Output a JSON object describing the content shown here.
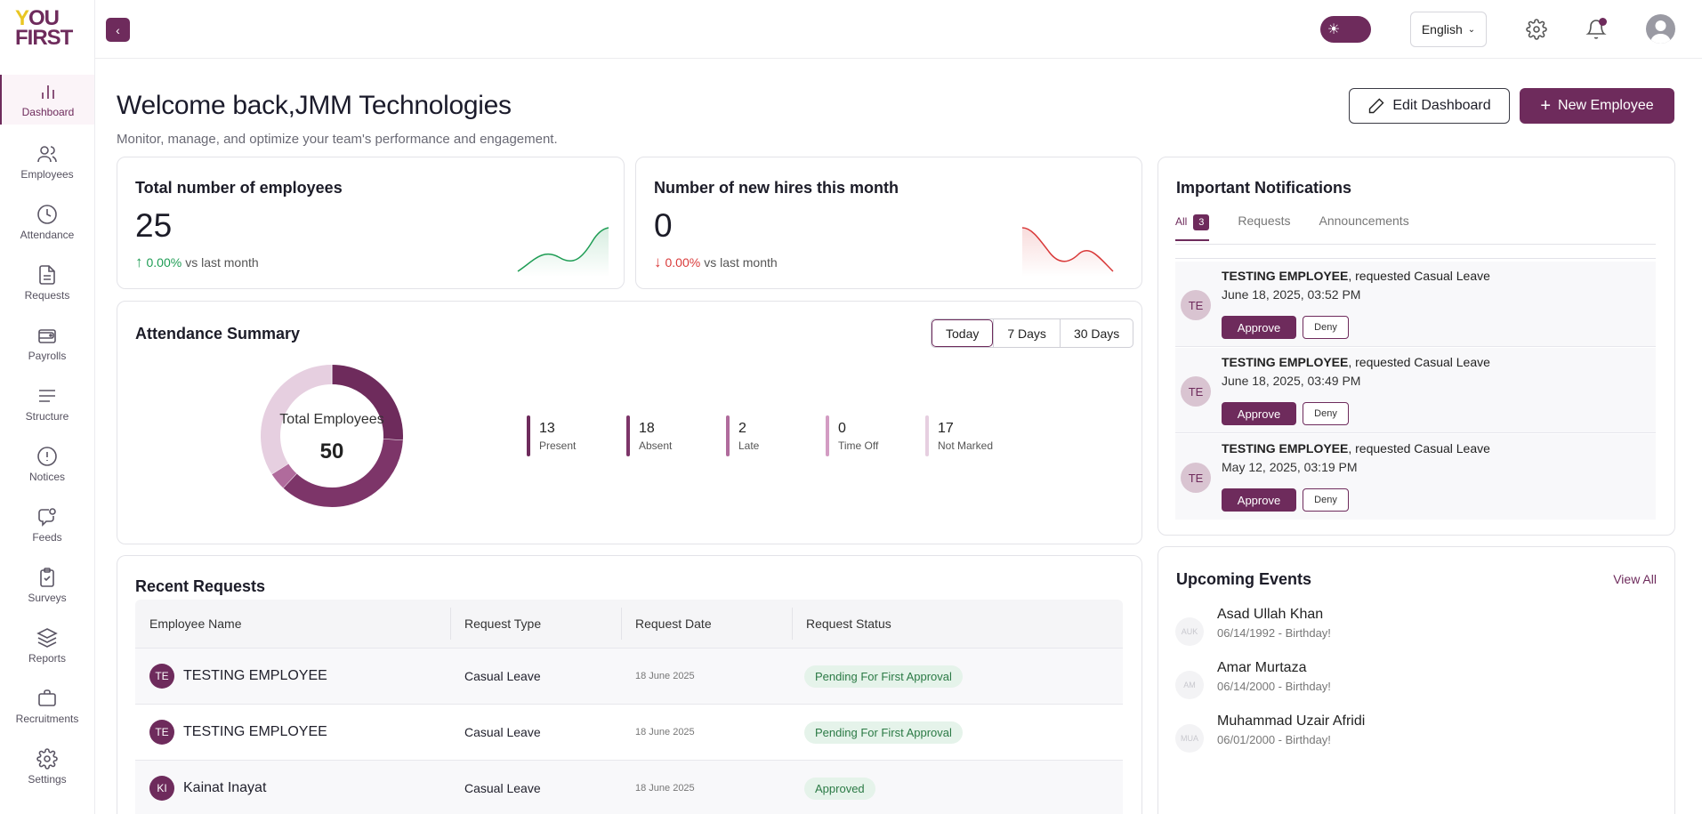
{
  "brand": {
    "line1_a": "Y",
    "line1_b": "OU",
    "line2": "FIRST"
  },
  "sidebar": {
    "items": [
      {
        "label": "Dashboard",
        "icon": "bar-chart-icon"
      },
      {
        "label": "Employees",
        "icon": "users-icon"
      },
      {
        "label": "Attendance",
        "icon": "clock-icon"
      },
      {
        "label": "Requests",
        "icon": "document-icon"
      },
      {
        "label": "Payrolls",
        "icon": "wallet-icon"
      },
      {
        "label": "Structure",
        "icon": "lines-icon"
      },
      {
        "label": "Notices",
        "icon": "alert-icon"
      },
      {
        "label": "Feeds",
        "icon": "chat-icon"
      },
      {
        "label": "Surveys",
        "icon": "clipboard-icon"
      },
      {
        "label": "Reports",
        "icon": "layers-icon"
      },
      {
        "label": "Recruitments",
        "icon": "briefcase-icon"
      },
      {
        "label": "Settings",
        "icon": "gear-icon"
      }
    ]
  },
  "topbar": {
    "language": "English"
  },
  "header": {
    "title": "Welcome back,JMM Technologies",
    "subtitle": "Monitor, manage, and optimize your team's performance and engagement.",
    "edit_label": "Edit Dashboard",
    "new_label": "New Employee"
  },
  "stats": {
    "total": {
      "title": "Total number of employees",
      "value": "25",
      "delta": "0.00%",
      "suffix": "vs last month",
      "color": "#1f9d55"
    },
    "hires": {
      "title": "Number of new hires this month",
      "value": "0",
      "delta": "0.00%",
      "suffix": "vs last month",
      "color": "#d93a3a"
    }
  },
  "attendance": {
    "title": "Attendance Summary",
    "ranges": [
      "Today",
      "7 Days",
      "30 Days"
    ],
    "selected_range": "Today",
    "center_label": "Total Employees",
    "center_value": "50",
    "legend": [
      {
        "value": "13",
        "label": "Present",
        "color": "#6e2b5c"
      },
      {
        "value": "18",
        "label": "Absent",
        "color": "#7d3569"
      },
      {
        "value": "2",
        "label": "Late",
        "color": "#b06b9c"
      },
      {
        "value": "0",
        "label": "Time Off",
        "color": "#d39cc3"
      },
      {
        "value": "17",
        "label": "Not Marked",
        "color": "#e6cfe0"
      }
    ]
  },
  "notifications": {
    "title": "Important Notifications",
    "tabs": {
      "all": "All",
      "count": "3",
      "requests": "Requests",
      "announcements": "Announcements"
    },
    "approve_label": "Approve",
    "deny_label": "Deny",
    "items": [
      {
        "initials": "TE",
        "name": "TESTING EMPLOYEE",
        "action": ", requested Casual Leave",
        "date": "June 18, 2025, 03:52 PM"
      },
      {
        "initials": "TE",
        "name": "TESTING EMPLOYEE",
        "action": ", requested Casual Leave",
        "date": "June 18, 2025, 03:49 PM"
      },
      {
        "initials": "TE",
        "name": "TESTING EMPLOYEE",
        "action": ", requested Casual Leave",
        "date": "May 12, 2025, 03:19 PM"
      }
    ]
  },
  "requests": {
    "title": "Recent Requests",
    "columns": [
      "Employee Name",
      "Request Type",
      "Request Date",
      "Request Status"
    ],
    "rows": [
      {
        "initials": "TE",
        "name": "TESTING EMPLOYEE",
        "type": "Casual Leave",
        "date": "18 June 2025",
        "status": "Pending For First Approval"
      },
      {
        "initials": "TE",
        "name": "TESTING EMPLOYEE",
        "type": "Casual Leave",
        "date": "18 June 2025",
        "status": "Pending For First Approval"
      },
      {
        "initials": "KI",
        "name": "Kainat Inayat",
        "type": "Casual Leave",
        "date": "18 June 2025",
        "status": "Approved"
      }
    ]
  },
  "events": {
    "title": "Upcoming Events",
    "view_all": "View All",
    "items": [
      {
        "initials": "AUK",
        "name": "Asad Ullah Khan",
        "sub": "06/14/1992 - Birthday!"
      },
      {
        "initials": "AM",
        "name": "Amar Murtaza",
        "sub": "06/14/2000 - Birthday!"
      },
      {
        "initials": "MUA",
        "name": "Muhammad Uzair Afridi",
        "sub": "06/01/2000 - Birthday!"
      }
    ]
  },
  "colors": {
    "brand": "#6e2b5c",
    "accent": "#e9c623"
  }
}
